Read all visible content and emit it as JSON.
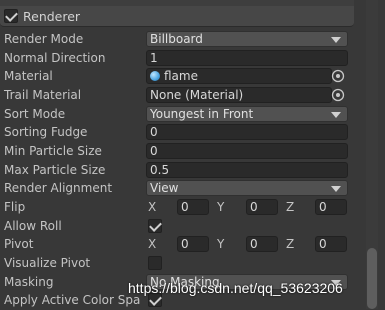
{
  "section": {
    "title": "Renderer",
    "enabled": true
  },
  "rows": {
    "render_mode": {
      "label": "Render Mode",
      "value": "Billboard"
    },
    "normal_direction": {
      "label": "Normal Direction",
      "value": "1"
    },
    "material": {
      "label": "Material",
      "value": "flame"
    },
    "trail_material": {
      "label": "Trail Material",
      "value": "None (Material)"
    },
    "sort_mode": {
      "label": "Sort Mode",
      "value": "Youngest in Front"
    },
    "sorting_fudge": {
      "label": "Sorting Fudge",
      "value": "0"
    },
    "min_particle_size": {
      "label": "Min Particle Size",
      "value": "0"
    },
    "max_particle_size": {
      "label": "Max Particle Size",
      "value": "0.5"
    },
    "render_alignment": {
      "label": "Render Alignment",
      "value": "View"
    },
    "flip": {
      "label": "Flip",
      "x": "0",
      "y": "0",
      "z": "0"
    },
    "allow_roll": {
      "label": "Allow Roll",
      "checked": true
    },
    "pivot": {
      "label": "Pivot",
      "x": "0",
      "y": "0",
      "z": "0"
    },
    "visualize_pivot": {
      "label": "Visualize Pivot",
      "checked": false
    },
    "masking": {
      "label": "Masking",
      "value": "No Masking"
    },
    "apply_active_color_space": {
      "label": "Apply Active Color Spa",
      "checked": true
    }
  },
  "axes": {
    "x": "X",
    "y": "Y",
    "z": "Z"
  },
  "watermark": "https://blog.csdn.net/qq_53623206",
  "icons": {
    "picker": "object-picker-icon",
    "dropdown": "chevron-down-icon",
    "material": "material-sphere-icon"
  }
}
